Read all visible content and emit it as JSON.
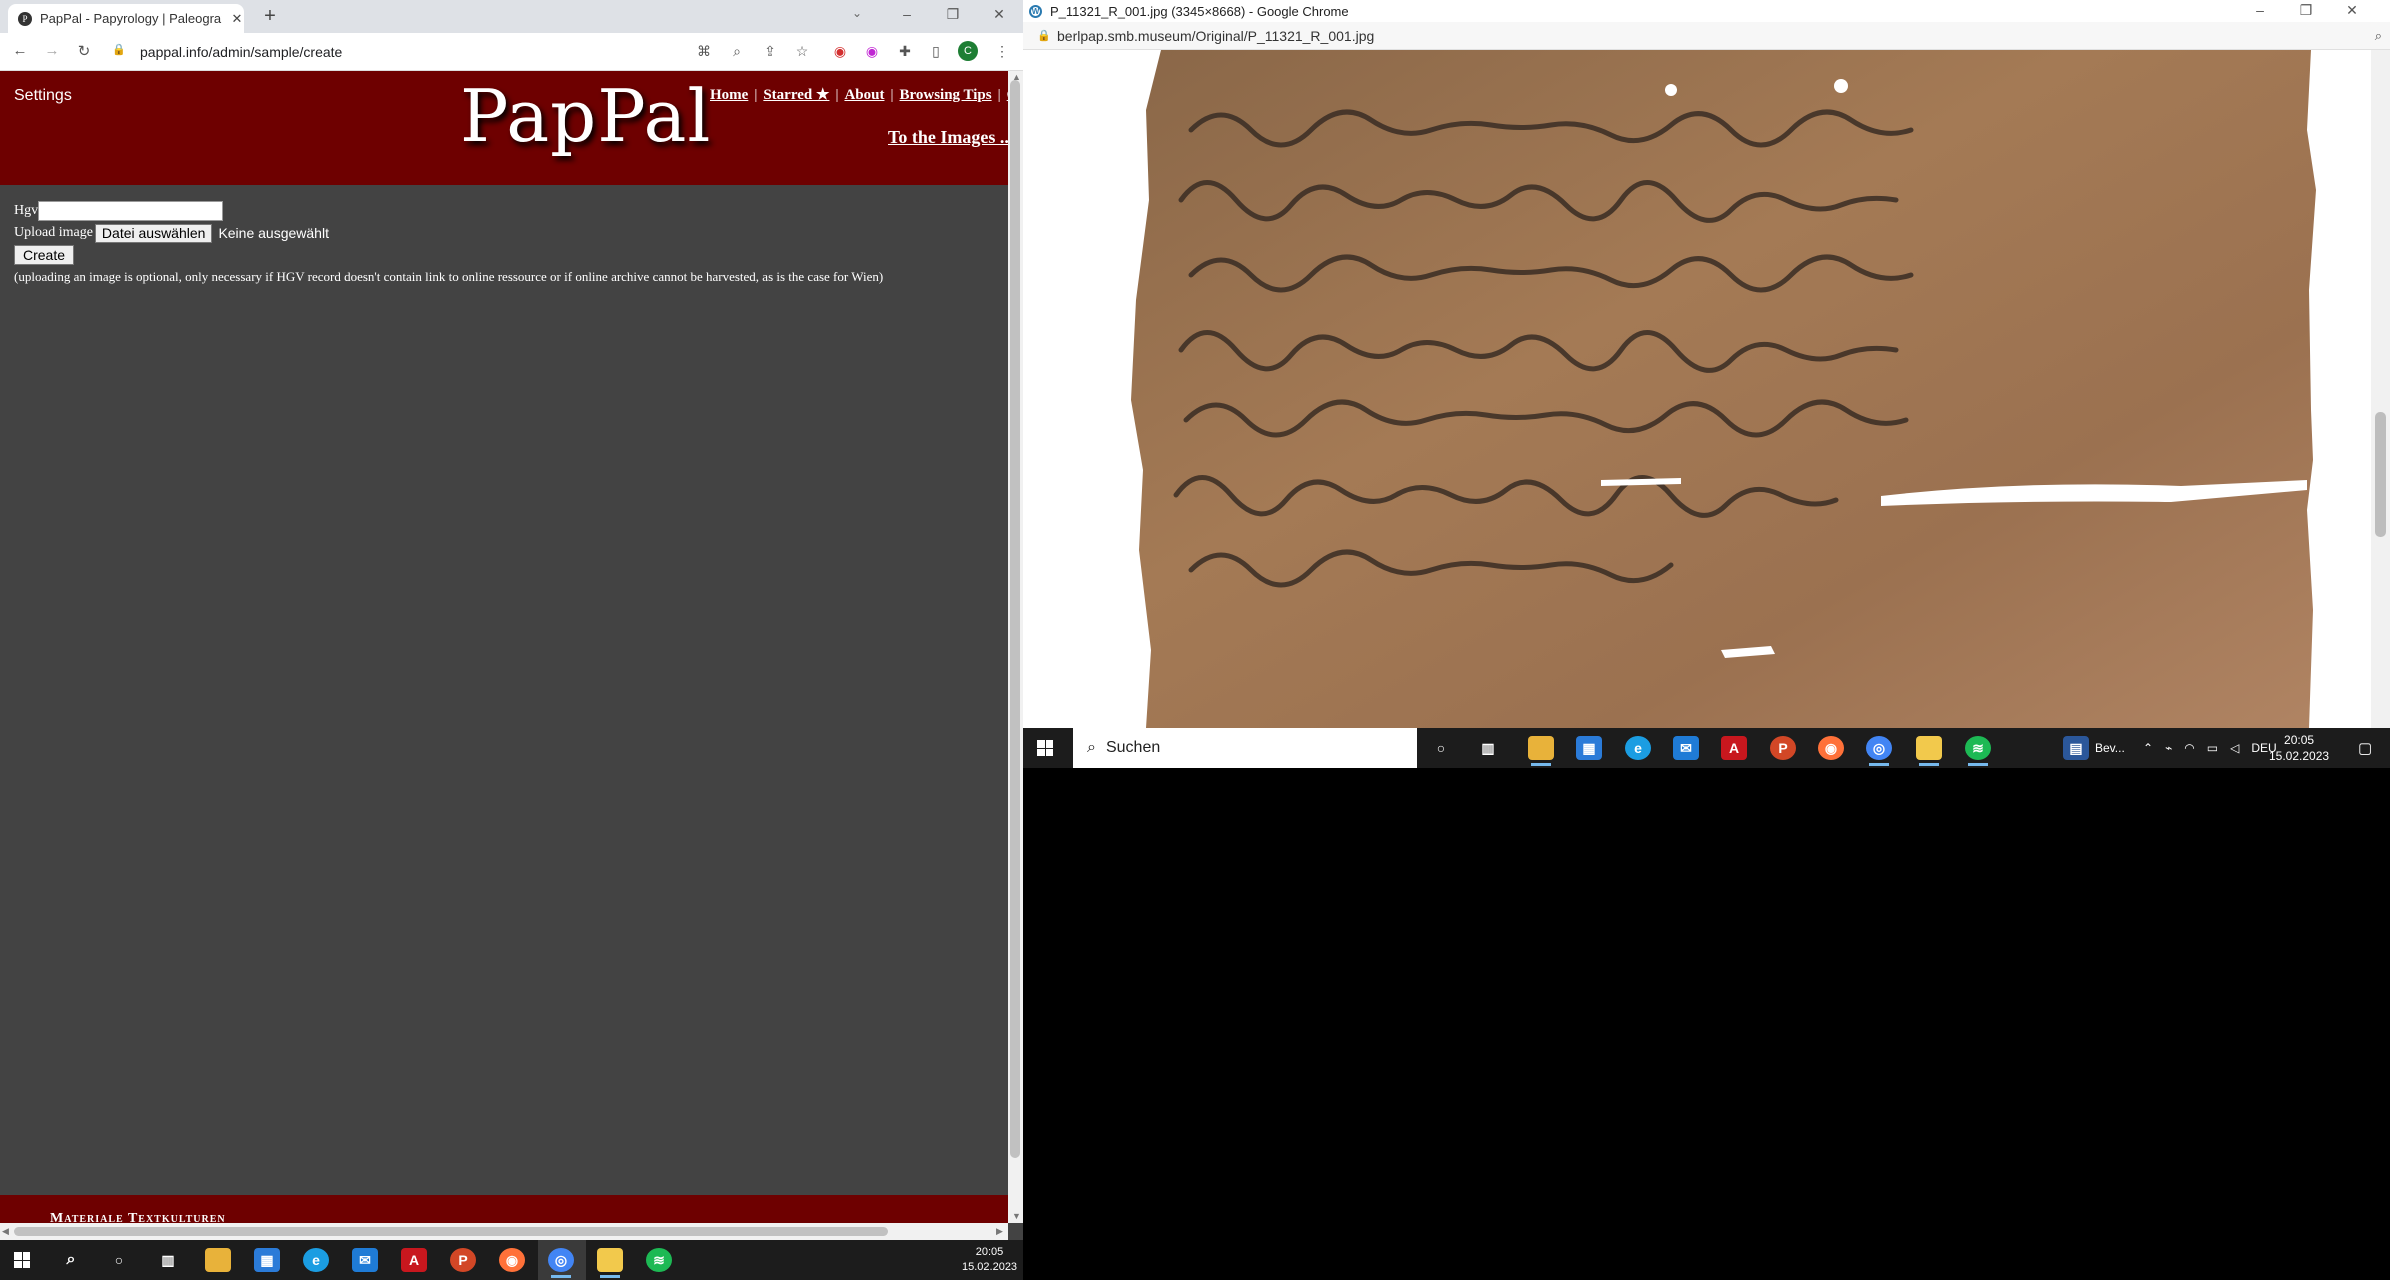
{
  "left_browser": {
    "tab_title": "PapPal - Papyrology | Paleography",
    "favicon_letter": "P",
    "url": "pappal.info/admin/sample/create",
    "profile_initial": "C",
    "page": {
      "settings": "Settings",
      "logo": "PapPal",
      "nav": [
        "Home",
        "Starred ★",
        "About",
        "Browsing Tips",
        "C"
      ],
      "to_images": "To the Images ...",
      "hgv_label": "Hgv",
      "hgv_value": "",
      "upload_label": "Upload image",
      "file_button": "Datei auswählen",
      "no_file": "Keine ausgewählt",
      "create_button": "Create",
      "note": "(uploading an image is optional, only necessary if HGV record doesn't contain link to online ressource or if online archive cannot be harvested, as is the case for Wien)",
      "footer_text": "Materiale Textkulturen"
    }
  },
  "right_browser": {
    "title": "P_11321_R_001.jpg (3345×8668) - Google Chrome",
    "url": "berlpap.smb.museum/Original/P_11321_R_001.jpg",
    "image_alt": "papyrus P 11321 recto"
  },
  "right_taskbar": {
    "search_placeholder": "Suchen",
    "pinned_label": "Bev...",
    "language": "DEU",
    "time": "20:05",
    "date": "15.02.2023"
  },
  "bottom_taskbar": {
    "time": "20:05",
    "date": "15.02.2023"
  },
  "colors": {
    "header_red": "#6e0000",
    "page_bg": "#434343"
  }
}
